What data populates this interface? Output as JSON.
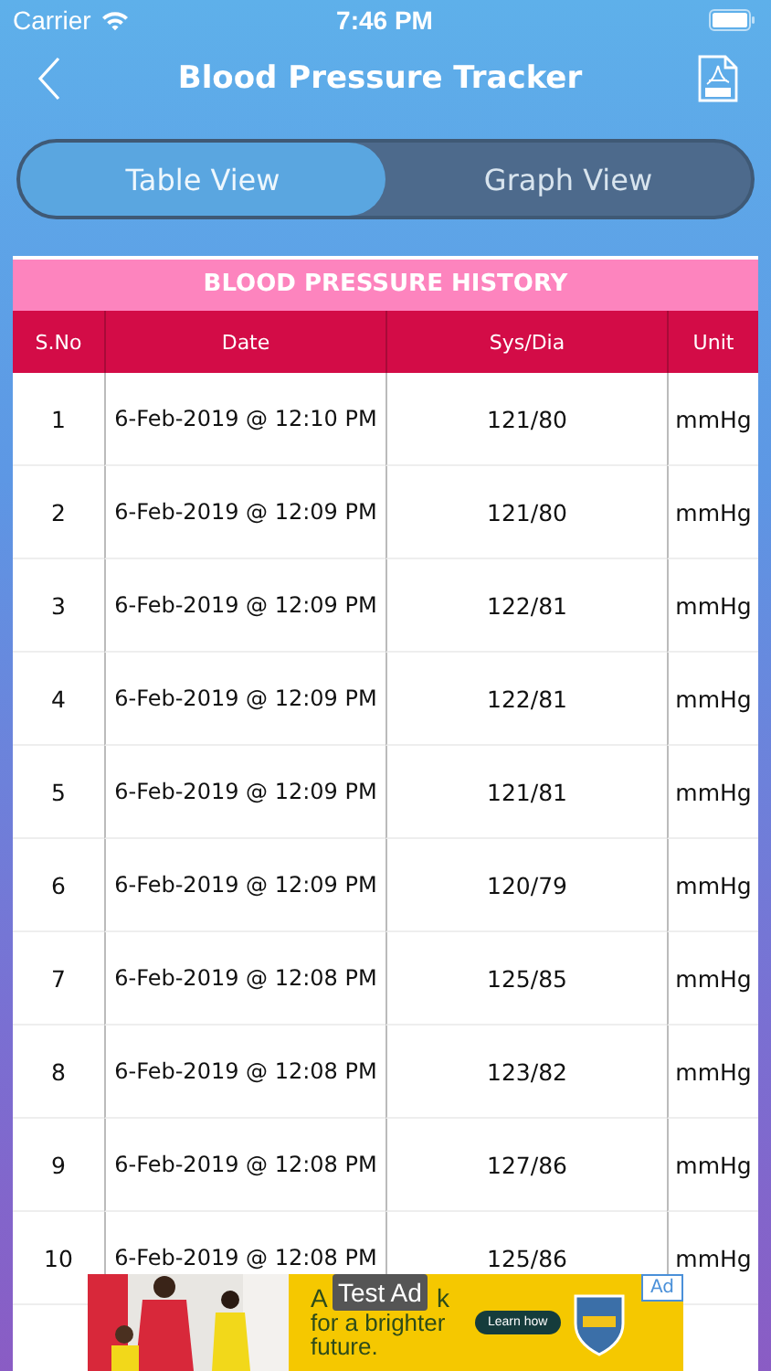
{
  "status_bar": {
    "carrier": "Carrier",
    "time": "7:46 PM"
  },
  "nav": {
    "title": "Blood Pressure Tracker"
  },
  "tabs": [
    {
      "label": "Table View",
      "selected": true
    },
    {
      "label": "Graph View",
      "selected": false
    }
  ],
  "table": {
    "title": "BLOOD PRESSURE HISTORY",
    "columns": [
      "S.No",
      "Date",
      "Sys/Dia",
      "Unit"
    ],
    "rows": [
      [
        "1",
        "6-Feb-2019 @ 12:10 PM",
        "121/80",
        "mmHg"
      ],
      [
        "2",
        "6-Feb-2019 @ 12:09 PM",
        "121/80",
        "mmHg"
      ],
      [
        "3",
        "6-Feb-2019 @ 12:09 PM",
        "122/81",
        "mmHg"
      ],
      [
        "4",
        "6-Feb-2019 @ 12:09 PM",
        "122/81",
        "mmHg"
      ],
      [
        "5",
        "6-Feb-2019 @ 12:09 PM",
        "121/81",
        "mmHg"
      ],
      [
        "6",
        "6-Feb-2019 @ 12:09 PM",
        "120/79",
        "mmHg"
      ],
      [
        "7",
        "6-Feb-2019 @ 12:08 PM",
        "125/85",
        "mmHg"
      ],
      [
        "8",
        "6-Feb-2019 @ 12:08 PM",
        "123/82",
        "mmHg"
      ],
      [
        "9",
        "6-Feb-2019 @ 12:08 PM",
        "127/86",
        "mmHg"
      ],
      [
        "10",
        "6-Feb-2019 @ 12:08 PM",
        "125/86",
        "mmHg"
      ]
    ]
  },
  "ad": {
    "label": "Test Ad",
    "headline_start": "A",
    "headline_end": "k",
    "body": "for a brighter future.",
    "button": "Learn how",
    "badge": "Ad"
  }
}
